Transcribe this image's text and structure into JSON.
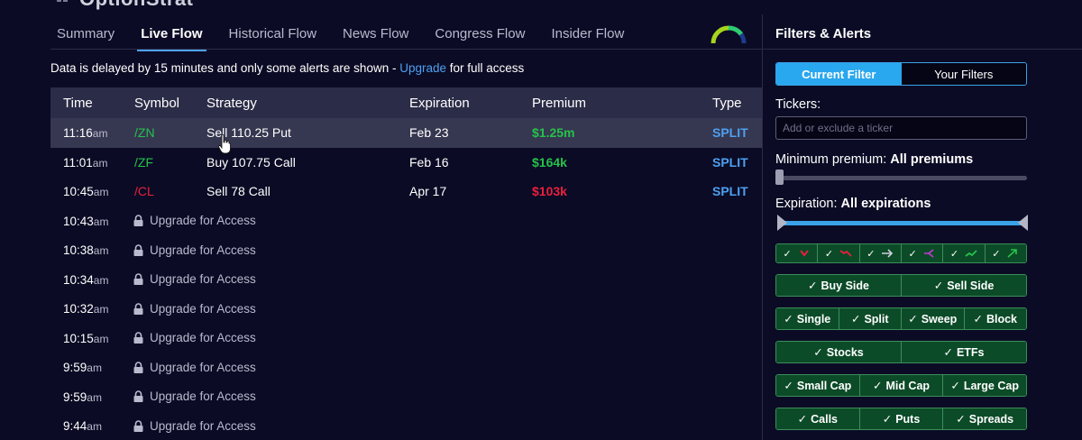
{
  "app": {
    "name": "OptionStrat"
  },
  "tabs": [
    {
      "label": "Summary",
      "active": false
    },
    {
      "label": "Live Flow",
      "active": true
    },
    {
      "label": "Historical Flow",
      "active": false
    },
    {
      "label": "News Flow",
      "active": false
    },
    {
      "label": "Congress Flow",
      "active": false
    },
    {
      "label": "Insider Flow",
      "active": false
    }
  ],
  "notice": {
    "text": "Data is delayed by 15 minutes and only some alerts are shown - ",
    "link": "Upgrade",
    "suffix": " for full access"
  },
  "table": {
    "headers": {
      "time": "Time",
      "symbol": "Symbol",
      "strategy": "Strategy",
      "expiration": "Expiration",
      "premium": "Premium",
      "type": "Type"
    },
    "rows": [
      {
        "time": "11:16",
        "ampm": "am",
        "symbol": "/ZN",
        "strategy": "Sell 110.25 Put",
        "expiration": "Feb 23",
        "premium": "$1.25m",
        "type": "SPLIT"
      },
      {
        "time": "11:01",
        "ampm": "am",
        "symbol": "/ZF",
        "strategy": "Buy 107.75 Call",
        "expiration": "Feb 16",
        "premium": "$164k",
        "type": "SPLIT"
      },
      {
        "time": "10:45",
        "ampm": "am",
        "symbol": "/CL",
        "strategy": "Sell 78 Call",
        "expiration": "Apr 17",
        "premium": "$103k",
        "type": "SPLIT"
      }
    ],
    "locked_rows": [
      {
        "time": "10:43",
        "ampm": "am",
        "text": "Upgrade for Access"
      },
      {
        "time": "10:38",
        "ampm": "am",
        "text": "Upgrade for Access"
      },
      {
        "time": "10:34",
        "ampm": "am",
        "text": "Upgrade for Access"
      },
      {
        "time": "10:32",
        "ampm": "am",
        "text": "Upgrade for Access"
      },
      {
        "time": "10:15",
        "ampm": "am",
        "text": "Upgrade for Access"
      },
      {
        "time": "9:59",
        "ampm": "am",
        "text": "Upgrade for Access"
      },
      {
        "time": "9:59",
        "ampm": "am",
        "text": "Upgrade for Access"
      },
      {
        "time": "9:44",
        "ampm": "am",
        "text": "Upgrade for Access"
      }
    ]
  },
  "panel": {
    "title": "Filters & Alerts",
    "toggle": {
      "current": "Current Filter",
      "yours": "Your Filters"
    },
    "tickers_label": "Tickers:",
    "tickers_placeholder": "Add or exclude a ticker",
    "min_premium_label": "Minimum premium: ",
    "min_premium_value": "All premiums",
    "expiration_label": "Expiration: ",
    "expiration_value": "All expirations",
    "side": [
      "Buy Side",
      "Sell Side"
    ],
    "exec_type": [
      "Single",
      "Split",
      "Sweep",
      "Block"
    ],
    "asset": [
      "Stocks",
      "ETFs"
    ],
    "cap": [
      "Small Cap",
      "Mid Cap",
      "Large Cap"
    ],
    "option": [
      "Calls",
      "Puts",
      "Spreads"
    ]
  },
  "colors": {
    "background": "#0b0b25",
    "accent": "#4ea0f0",
    "green": "#25c24a",
    "red": "#e8203e",
    "filter_green": "#0c4b28"
  }
}
